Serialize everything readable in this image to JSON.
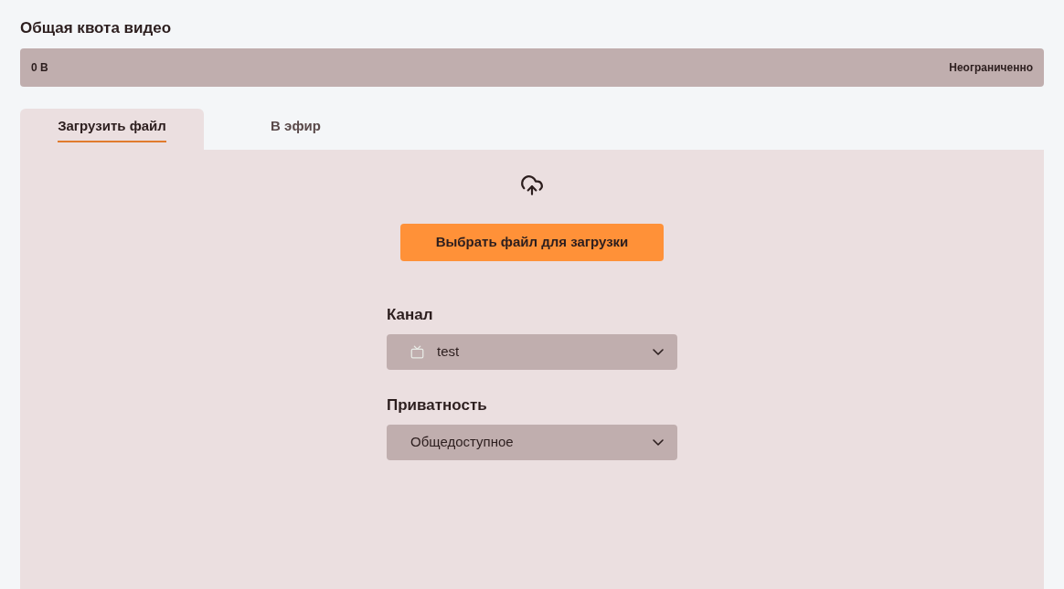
{
  "quota": {
    "title": "Общая квота видео",
    "used": "0 B",
    "limit": "Неограниченно"
  },
  "tabs": [
    {
      "label": "Загрузить файл",
      "selected": true
    },
    {
      "label": "В эфир",
      "selected": false
    }
  ],
  "upload": {
    "button": "Выбрать файл для загрузки"
  },
  "fields": [
    {
      "label": "Канал",
      "value": "test",
      "kind": "channel"
    },
    {
      "label": "Приватность",
      "value": "Общедоступное",
      "kind": "plain"
    }
  ]
}
